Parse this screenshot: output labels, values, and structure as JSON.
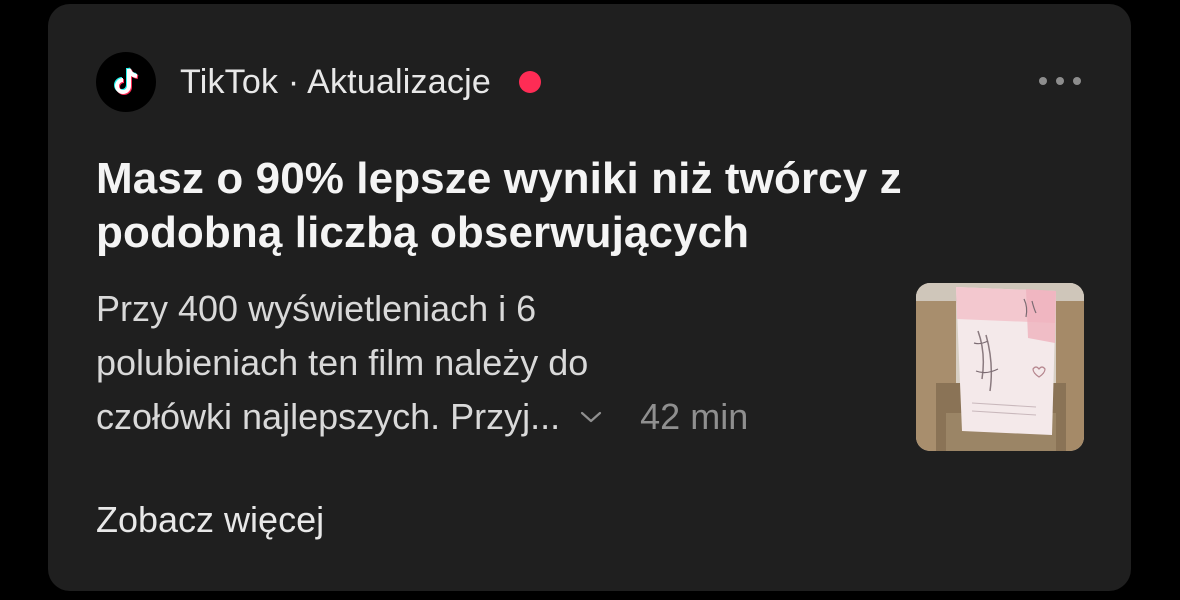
{
  "notification": {
    "app_name": "TikTok · Aktualizacje",
    "app_icon": "tiktok-logo-icon",
    "unread_color": "#fe2c55",
    "more_icon": "more-horizontal-icon",
    "title": "Masz o 90% lepsze wyniki niż twórcy z podobną liczbą obserwujących",
    "body_lines": [
      "Przy 400 wyświetleniach i 6",
      "polubieniach ten film należy do",
      "czołówki najlepszych. Przyj..."
    ],
    "expand_icon": "chevron-down-icon",
    "timestamp": "42 min",
    "thumbnail_icon": "video-thumbnail",
    "see_more_label": "Zobacz więcej"
  },
  "colors": {
    "card_background": "#1f1f1f",
    "page_background": "#000000",
    "title_text": "#f4f4f4",
    "secondary_text": "#8f8f8f"
  }
}
